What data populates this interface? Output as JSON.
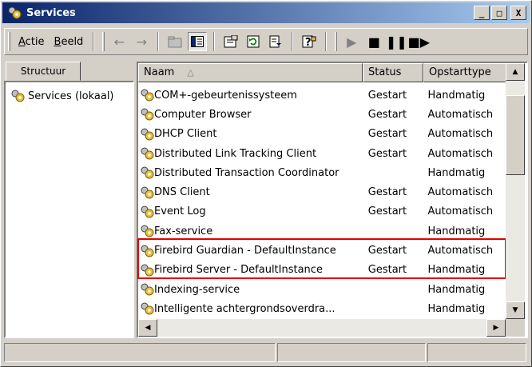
{
  "window": {
    "title": "Services",
    "minimize": "_",
    "maximize": "□",
    "close": "X"
  },
  "menu": {
    "actie": "Actie",
    "beeld": "Beeld"
  },
  "left_pane": {
    "tab": "Structuur",
    "tree_item": "Services (lokaal)"
  },
  "columns": {
    "name": "Naam",
    "status": "Status",
    "startup": "Opstarttype"
  },
  "services": [
    {
      "name": "COM+-gebeurtenissysteem",
      "status": "Gestart",
      "startup": "Handmatig"
    },
    {
      "name": "Computer Browser",
      "status": "Gestart",
      "startup": "Automatisch"
    },
    {
      "name": "DHCP Client",
      "status": "Gestart",
      "startup": "Automatisch"
    },
    {
      "name": "Distributed Link Tracking Client",
      "status": "Gestart",
      "startup": "Automatisch"
    },
    {
      "name": "Distributed Transaction Coordinator",
      "status": "",
      "startup": "Handmatig"
    },
    {
      "name": "DNS Client",
      "status": "Gestart",
      "startup": "Automatisch"
    },
    {
      "name": "Event Log",
      "status": "Gestart",
      "startup": "Automatisch"
    },
    {
      "name": "Fax-service",
      "status": "",
      "startup": "Handmatig"
    },
    {
      "name": "Firebird Guardian - DefaultInstance",
      "status": "Gestart",
      "startup": "Automatisch"
    },
    {
      "name": "Firebird Server - DefaultInstance",
      "status": "Gestart",
      "startup": "Handmatig"
    },
    {
      "name": "Indexing-service",
      "status": "",
      "startup": "Handmatig"
    },
    {
      "name": "Intelligente achtergrondsoverdra...",
      "status": "",
      "startup": "Handmatig"
    }
  ],
  "colors": {
    "highlight_box": "#e60000",
    "titlebar_start": "#0a246a",
    "titlebar_end": "#a6caf0"
  }
}
